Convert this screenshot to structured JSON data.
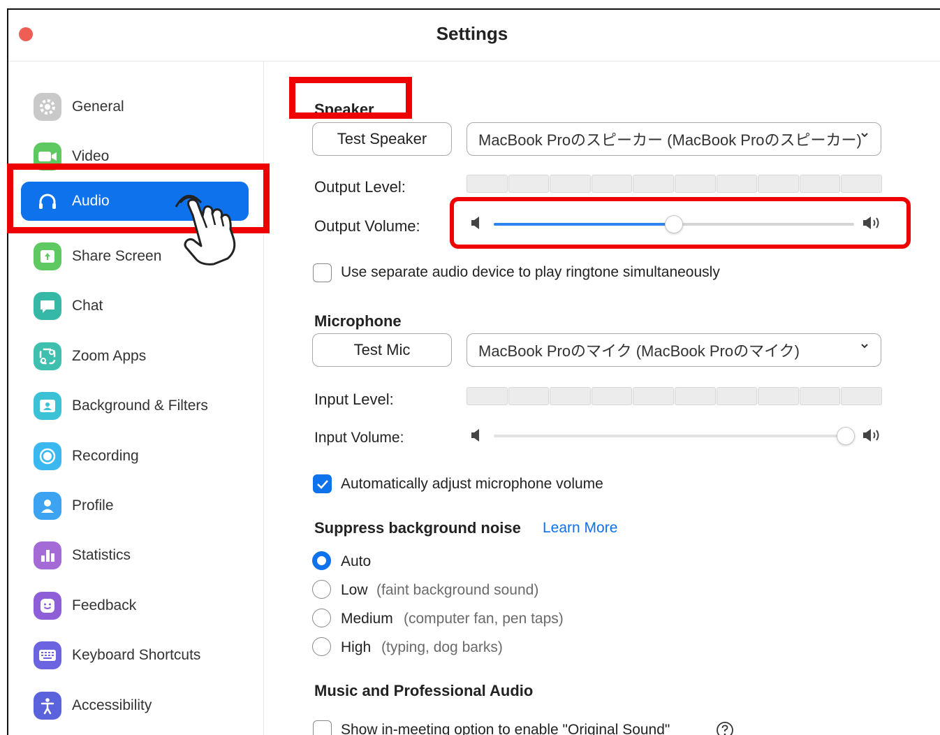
{
  "window": {
    "title": "Settings"
  },
  "sidebar": {
    "items": [
      {
        "label": "General",
        "icon": "gear-icon",
        "color": "#c4c4c4"
      },
      {
        "label": "Video",
        "icon": "video-camera-icon",
        "color": "#5fc961"
      },
      {
        "label": "Audio",
        "icon": "headphones-icon",
        "color": "#0e72ed",
        "active": true
      },
      {
        "label": "Share Screen",
        "icon": "share-screen-icon",
        "color": "#5fc961"
      },
      {
        "label": "Chat",
        "icon": "chat-bubble-icon",
        "color": "#35b8a6"
      },
      {
        "label": "Zoom Apps",
        "icon": "apps-icon",
        "color": "#3fbfae"
      },
      {
        "label": "Background & Filters",
        "icon": "background-icon",
        "color": "#3cc2d6"
      },
      {
        "label": "Recording",
        "icon": "record-icon",
        "color": "#3ab8ef"
      },
      {
        "label": "Profile",
        "icon": "profile-icon",
        "color": "#3ba3f2"
      },
      {
        "label": "Statistics",
        "icon": "bar-chart-icon",
        "color": "#a46ad6"
      },
      {
        "label": "Feedback",
        "icon": "smiley-icon",
        "color": "#8e5ed8"
      },
      {
        "label": "Keyboard Shortcuts",
        "icon": "keyboard-icon",
        "color": "#6b63e0"
      },
      {
        "label": "Accessibility",
        "icon": "accessibility-icon",
        "color": "#5a62dc"
      }
    ]
  },
  "speaker": {
    "title": "Speaker",
    "test_button": "Test Speaker",
    "device": "MacBook Proのスピーカー (MacBook Proのスピーカー)",
    "output_level_label": "Output Level:",
    "output_volume_label": "Output Volume:",
    "output_volume": 0.5,
    "ringtone_checkbox_label": "Use separate audio device to play ringtone simultaneously",
    "ringtone_checked": false
  },
  "microphone": {
    "title": "Microphone",
    "test_button": "Test Mic",
    "device": "MacBook Proのマイク (MacBook Proのマイク)",
    "input_level_label": "Input Level:",
    "input_volume_label": "Input Volume:",
    "input_volume": 1.0,
    "auto_adjust_label": "Automatically adjust microphone volume",
    "auto_adjust_checked": true
  },
  "noise": {
    "title": "Suppress background noise",
    "learn_more": "Learn More",
    "options": [
      {
        "label": "Auto",
        "hint": "",
        "selected": true
      },
      {
        "label": "Low",
        "hint": "(faint background sound)",
        "selected": false
      },
      {
        "label": "Medium",
        "hint": "(computer fan, pen taps)",
        "selected": false
      },
      {
        "label": "High",
        "hint": "(typing, dog barks)",
        "selected": false
      }
    ]
  },
  "music": {
    "title": "Music and Professional Audio",
    "original_sound_label": "Show in-meeting option to enable \"Original Sound\"",
    "original_sound_checked": false
  },
  "colors": {
    "accent": "#0e72ed",
    "highlight_box": "#ee0000"
  }
}
